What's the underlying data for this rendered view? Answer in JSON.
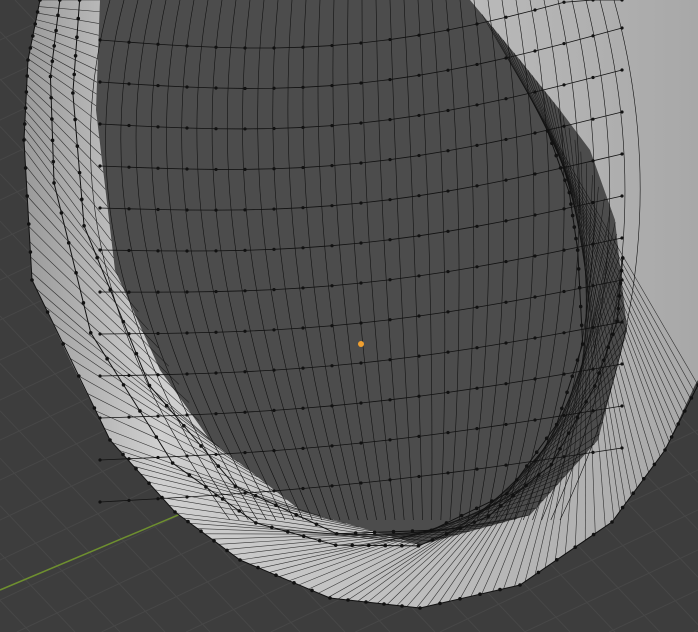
{
  "viewport": {
    "background": "#3d3d3d",
    "grid_line": "#474747",
    "x_axis_color": "#6e8f2f",
    "origin_color": "#f0a030",
    "mesh_light": "#c4c4c4",
    "mesh_dark": "#8a8a8a",
    "hole_color": "#4c4c4c",
    "wire_color": "#111111"
  }
}
